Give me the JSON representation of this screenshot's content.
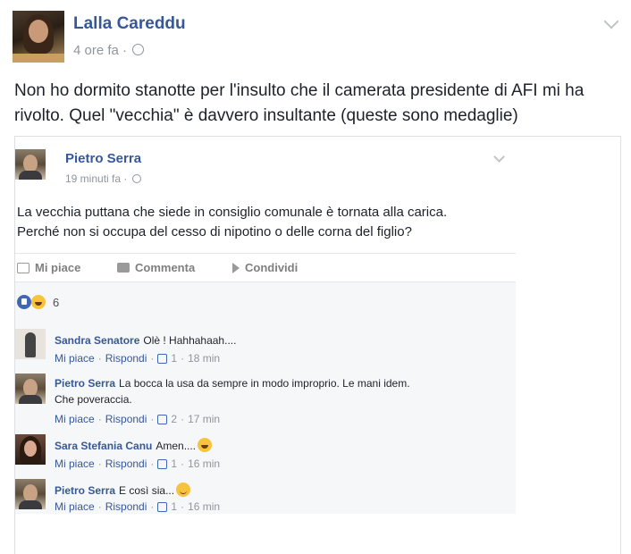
{
  "post": {
    "author": "Lalla Careddu",
    "time": "4 ore fa",
    "separator": "·",
    "text": "Non ho dormito stanotte per l'insulto che il camerata presidente di AFI mi ha rivolto. Quel \"vecchia\" è davvero insultante (queste sono medaglie)"
  },
  "shared_post": {
    "author": "Pietro Serra",
    "time": "19 minuti fa",
    "separator": "·",
    "text_line1": "La vecchia puttana che siede in consiglio comunale è tornata alla carica.",
    "text_line2": "Perché non si occupa del cesso di nipotino o delle corna del figlio?",
    "actions": {
      "like": "Mi piace",
      "comment": "Commenta",
      "share": "Condividi"
    },
    "reactions_count": "6",
    "comments": [
      {
        "name": "Sandra Senatore",
        "text": "Olè ! Hahhahaah....",
        "like": "Mi piace",
        "reply": "Rispondi",
        "likes": "1",
        "time": "18 min",
        "avatar": "sandra-avatar"
      },
      {
        "name": "Pietro Serra",
        "text_line1": "La bocca la usa da sempre in modo improprio. Le mani idem.",
        "text_line2": "Che poveraccia.",
        "like": "Mi piace",
        "reply": "Rispondi",
        "likes": "2",
        "time": "17 min",
        "avatar": "pietro-avatar"
      },
      {
        "name": "Sara Stefania Canu",
        "text": "Amen....",
        "emoji": "laughing-emoji",
        "like": "Mi piace",
        "reply": "Rispondi",
        "likes": "1",
        "time": "16 min",
        "avatar": "sara-avatar"
      },
      {
        "name": "Pietro Serra",
        "text": "E così sia...",
        "emoji": "smile-emoji",
        "like": "Mi piace",
        "reply": "Rispondi",
        "likes": "1",
        "time": "16 min",
        "avatar": "pietro-avatar"
      }
    ]
  },
  "colors": {
    "link": "#365899",
    "meta": "#90949c",
    "comments_bg": "#f6f7f9"
  }
}
